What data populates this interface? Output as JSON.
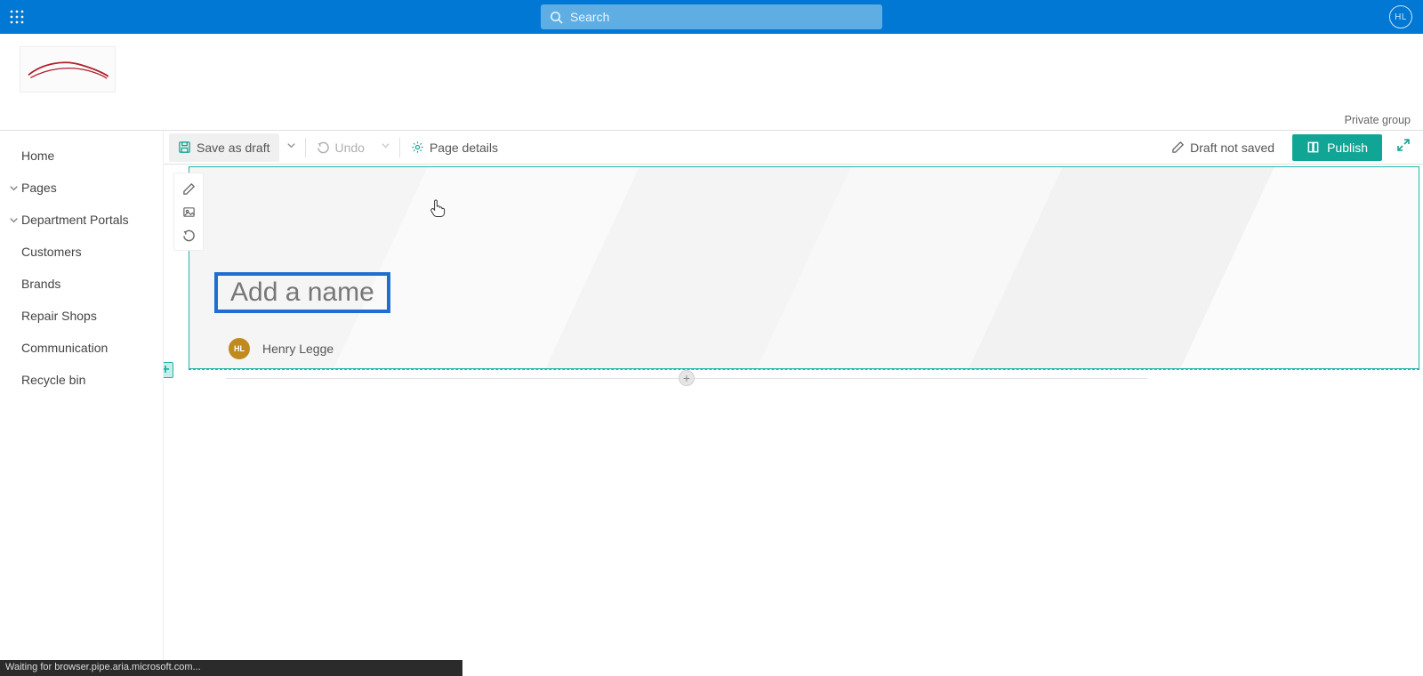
{
  "header": {
    "search_placeholder": "Search",
    "avatar_initials": "HL",
    "private_group": "Private group"
  },
  "nav": {
    "items": [
      {
        "label": "Home",
        "collapsible": false
      },
      {
        "label": "Pages",
        "collapsible": true
      },
      {
        "label": "Department Portals",
        "collapsible": true
      },
      {
        "label": "Customers",
        "collapsible": false
      },
      {
        "label": "Brands",
        "collapsible": false
      },
      {
        "label": "Repair Shops",
        "collapsible": false
      },
      {
        "label": "Communication",
        "collapsible": false
      },
      {
        "label": "Recycle bin",
        "collapsible": false
      }
    ]
  },
  "cmd": {
    "save_as_draft": "Save as draft",
    "undo": "Undo",
    "page_details": "Page details",
    "draft_not_saved": "Draft not saved",
    "publish": "Publish"
  },
  "page": {
    "title_placeholder": "Add a name",
    "author_initials": "HL",
    "author_name": "Henry Legge"
  },
  "status": {
    "text": "Waiting for browser.pipe.aria.microsoft.com..."
  }
}
